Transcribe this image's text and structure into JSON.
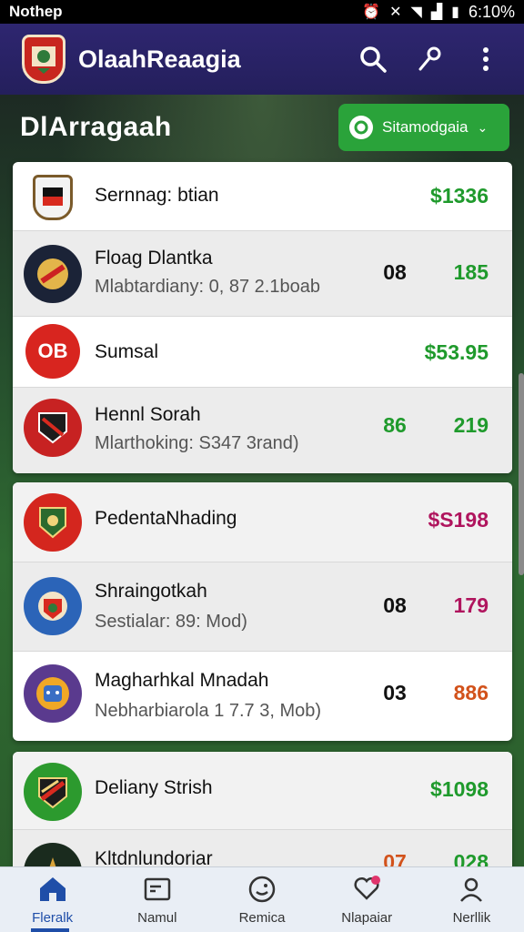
{
  "status_bar": {
    "app": "Nothep",
    "time": "6:10%"
  },
  "app_bar": {
    "title": "OlaahReaagia"
  },
  "section": {
    "title": "DlArragaah",
    "chip_label": "Sitamodgaia"
  },
  "cards": [
    {
      "rows": [
        {
          "name": "Sernnag: btian",
          "sub": "",
          "mid": "",
          "value": "$1336",
          "value_color": "#1f9a2c",
          "badge_type": "shield",
          "badge_bg": "#f3f3f3"
        },
        {
          "name": "Floag Dlantka",
          "sub": "Mlabtardiany: 0, 87 2.1boab",
          "mid": "08",
          "value": "185",
          "value_color": "#1f9a2c",
          "badge_type": "circle",
          "badge_bg": "#1b2337"
        },
        {
          "name": "Sumsal",
          "sub": "",
          "mid": "",
          "value": "$53.95",
          "value_color": "#1f9a2c",
          "badge_type": "text",
          "badge_text": "OB",
          "badge_bg": "#d8251f"
        },
        {
          "name": "Hennl Sorah",
          "sub": "Mlarthoking: S347 3rand)",
          "mid": "86",
          "mid_color": "#1f9a2c",
          "value": "219",
          "value_color": "#1f9a2c",
          "badge_type": "circle",
          "badge_bg": "#c72222"
        }
      ]
    },
    {
      "rows": [
        {
          "name": "PedentaNhading",
          "sub": "",
          "mid": "",
          "value": "$S198",
          "value_color": "#b0155e",
          "badge_type": "circle",
          "badge_bg": "#d4261e"
        },
        {
          "name": "Shraingotkah",
          "sub": "Sestialar: 89: Mod)",
          "mid": "08",
          "value": "179",
          "value_color": "#b0155e",
          "badge_type": "circle",
          "badge_bg": "#2b64b8"
        },
        {
          "name": "Magharhkal Mnadah",
          "sub": "Nebharbiarola 1 7.7 3, Mob)",
          "mid": "03",
          "value": "886",
          "value_color": "#d2521b",
          "badge_type": "circle",
          "badge_bg": "#5a3a8e"
        }
      ]
    },
    {
      "rows": [
        {
          "name": "Deliany Strish",
          "sub": "",
          "mid": "",
          "value": "$1098",
          "value_color": "#1f9a2c",
          "badge_type": "circle",
          "badge_bg": "#2c9a2e"
        },
        {
          "name": "Kltdnlundoriar",
          "sub": "",
          "mid": "07",
          "mid_color": "#d2521b",
          "value": "028",
          "value_color": "#1f9a2c",
          "badge_type": "circle",
          "badge_bg": "#1a2b1e"
        }
      ]
    }
  ],
  "bottom_nav": [
    {
      "label": "Fleralk",
      "icon": "home-icon",
      "active": true
    },
    {
      "label": "Namul",
      "icon": "inbox-icon",
      "active": false
    },
    {
      "label": "Remica",
      "icon": "smile-icon",
      "active": false
    },
    {
      "label": "Nlapaiar",
      "icon": "heart-chat-icon",
      "active": false
    },
    {
      "label": "Nerllik",
      "icon": "user-icon",
      "active": false
    }
  ]
}
